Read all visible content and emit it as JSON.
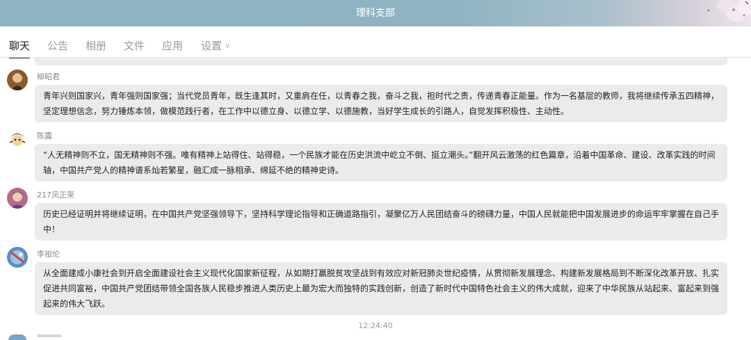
{
  "window": {
    "title": "理科支部"
  },
  "tabs": [
    {
      "label": "聊天",
      "active": true
    },
    {
      "label": "公告",
      "active": false
    },
    {
      "label": "相册",
      "active": false
    },
    {
      "label": "文件",
      "active": false
    },
    {
      "label": "应用",
      "active": false
    },
    {
      "label": "设置",
      "active": false,
      "has_dropdown": true
    }
  ],
  "messages": [
    {
      "sender": "柳昭君",
      "avatar": "portrait-avatar",
      "text": "青年兴则国家兴，青年强则国家强；当代党员青年，既生逢其时，又重肩在任，以青春之我，奋斗之我，担时代之责，传递青春正能量。作为一名基层的教师，我将继续传承五四精神，坚定理想信念，努力锤炼本领，做模范践行者，在工作中以德立身、以德立学、以德施教，当好学生成长的引路人，自觉发挥积极性、主动性。"
    },
    {
      "sender": "陈露",
      "avatar": "cartoon-avatar",
      "text": "“人无精神则不立，国无精神则不强。唯有精神上站得住、站得稳，一个民族才能在历史洪流中屹立不倒、挺立潮头。”翻开风云激荡的红色篇章，沿着中国革命、建设、改革实践的时间轴，中国共产党人的精神谱系灿若繁星，融汇成一脉相承、绵延不绝的精神史诗。"
    },
    {
      "sender": "217凤正荣",
      "avatar": "photo-avatar",
      "text": "历史已经证明并将继续证明，在中国共产党坚强领导下，坚持科学理论指导和正确道路指引，凝聚亿万人民团结奋斗的磅礴力量，中国人民就能把中国发展进步的命运牢牢掌握在自己手中！"
    },
    {
      "sender": "李祖伦",
      "avatar": "blue-red-avatar",
      "text": "从全面建成小康社会到开启全面建设社会主义现代化国家新征程，从如期打赢脱贫攻坚战到有效应对新冠肺炎世纪疫情，从贯彻新发展理念、构建新发展格局到不断深化改革开放、扎实促进共同富裕，中国共产党团结带领全国各族人民稳步推进人类历史上最为宏大而独特的实践创新，创造了新时代中国特色社会主义的伟大成就，迎来了中华民族从站起来、富起来到强起来的伟大飞跃。"
    }
  ],
  "timestamp": "12:24:40",
  "colors": {
    "titlebar": "#8fb4c4",
    "bubble": "#ebebeb",
    "active_tab": "#222222",
    "inactive_tab": "#999999"
  }
}
